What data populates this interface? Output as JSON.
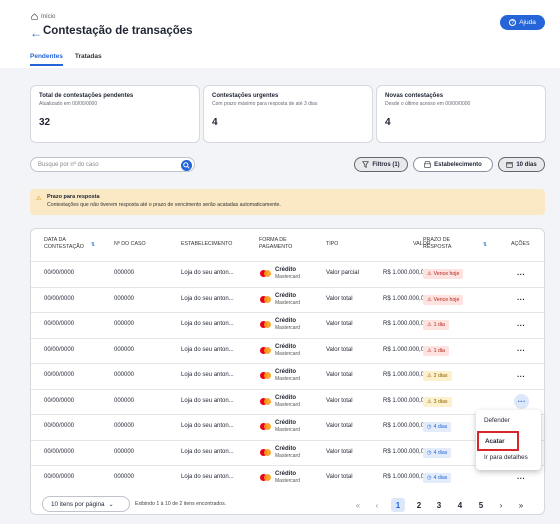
{
  "header": {
    "breadcrumb": "Início",
    "back_arrow": "←",
    "title": "Contestação de transações",
    "help_label": "Ajuda"
  },
  "tabs": [
    {
      "label": "Pendentes",
      "active": true
    },
    {
      "label": "Tratadas",
      "active": false
    }
  ],
  "cards": [
    {
      "title": "Total de contestações pendentes",
      "subtitle": "Atualizado em 00/00/0000",
      "value": "32"
    },
    {
      "title": "Contestações urgentes",
      "subtitle": "Com prazo máximo para resposta de até 3 dias",
      "value": "4"
    },
    {
      "title": "Novas contestações",
      "subtitle": "Desde o último acesso em 00/00/0000",
      "value": "4"
    }
  ],
  "search": {
    "placeholder": "Busque por nº do caso"
  },
  "filters": {
    "filtros_label": "Filtros (1)",
    "estabelecimento_label": "Estabelecimento",
    "period_label": "10 dias"
  },
  "alert": {
    "title": "Prazo para resposta",
    "text": "Contestações que não tiverem resposta até o prazo de vencimento serão acatadas automaticamente."
  },
  "table": {
    "headers": {
      "date": [
        "Data da",
        "contestação"
      ],
      "case": "Nº do caso",
      "estab": "Estabelecimento",
      "payment": [
        "Forma de",
        "pagamento"
      ],
      "type": "Tipo",
      "value": "Valor",
      "deadline": [
        "Prazo de",
        "resposta"
      ],
      "actions": "Ações"
    },
    "rows": [
      {
        "date": "00/00/0000",
        "case": "000000",
        "estab": "Loja do seu anton...",
        "pay": "Crédito",
        "brand": "Mastercard",
        "type": "Valor parcial",
        "value": "R$ 1.000.000,00",
        "deadline": "Vence hoje",
        "status": "red",
        "icon": "⚠"
      },
      {
        "date": "00/00/0000",
        "case": "000000",
        "estab": "Loja do seu anton...",
        "pay": "Crédito",
        "brand": "Mastercard",
        "type": "Valor total",
        "value": "R$ 1.000.000,00",
        "deadline": "Vence hoje",
        "status": "red",
        "icon": "⚠"
      },
      {
        "date": "00/00/0000",
        "case": "000000",
        "estab": "Loja do seu anton...",
        "pay": "Crédito",
        "brand": "Mastercard",
        "type": "Valor total",
        "value": "R$ 1.000.000,00",
        "deadline": "1 dia",
        "status": "red",
        "icon": "⚠"
      },
      {
        "date": "00/00/0000",
        "case": "000000",
        "estab": "Loja do seu anton...",
        "pay": "Crédito",
        "brand": "Mastercard",
        "type": "Valor total",
        "value": "R$ 1.000.000,00",
        "deadline": "1 dia",
        "status": "red",
        "icon": "⚠"
      },
      {
        "date": "00/00/0000",
        "case": "000000",
        "estab": "Loja do seu anton...",
        "pay": "Crédito",
        "brand": "Mastercard",
        "type": "Valor total",
        "value": "R$ 1.000.000,00",
        "deadline": "2 dias",
        "status": "amber",
        "icon": "⚠"
      },
      {
        "date": "00/00/0000",
        "case": "000000",
        "estab": "Loja do seu anton...",
        "pay": "Crédito",
        "brand": "Mastercard",
        "type": "Valor total",
        "value": "R$ 1.000.000,00",
        "deadline": "3 dias",
        "status": "amber",
        "icon": "⚠"
      },
      {
        "date": "00/00/0000",
        "case": "000000",
        "estab": "Loja do seu anton...",
        "pay": "Crédito",
        "brand": "Mastercard",
        "type": "Valor total",
        "value": "R$ 1.000.000,00",
        "deadline": "4 dias",
        "status": "blue",
        "icon": "◷"
      },
      {
        "date": "00/00/0000",
        "case": "000000",
        "estab": "Loja do seu anton...",
        "pay": "Crédito",
        "brand": "Mastercard",
        "type": "Valor total",
        "value": "R$ 1.000.000,00",
        "deadline": "4 dias",
        "status": "blue",
        "icon": "◷"
      },
      {
        "date": "00/00/0000",
        "case": "000000",
        "estab": "Loja do seu anton...",
        "pay": "Crédito",
        "brand": "Mastercard",
        "type": "Valor total",
        "value": "R$ 1.000.000,00",
        "deadline": "4 dias",
        "status": "blue",
        "icon": "◷"
      }
    ],
    "action_glyph": "···"
  },
  "context_menu": {
    "items": [
      "Defender",
      "Acatar",
      "Ir para detalhes"
    ],
    "selected": "Acatar"
  },
  "pagination": {
    "per_page": "10 itens por página",
    "info": "Exibindo 1 à 10 de 2 itens encontrados.",
    "pages": [
      "1",
      "2",
      "3",
      "4",
      "5"
    ],
    "current": "1",
    "first": "«",
    "prev": "‹",
    "next": "›",
    "last": "»"
  },
  "colors": {
    "accent": "#2565d8",
    "alert_bg": "#fbe8c4",
    "danger": "#b42318",
    "highlight_border": "#d8262c"
  }
}
